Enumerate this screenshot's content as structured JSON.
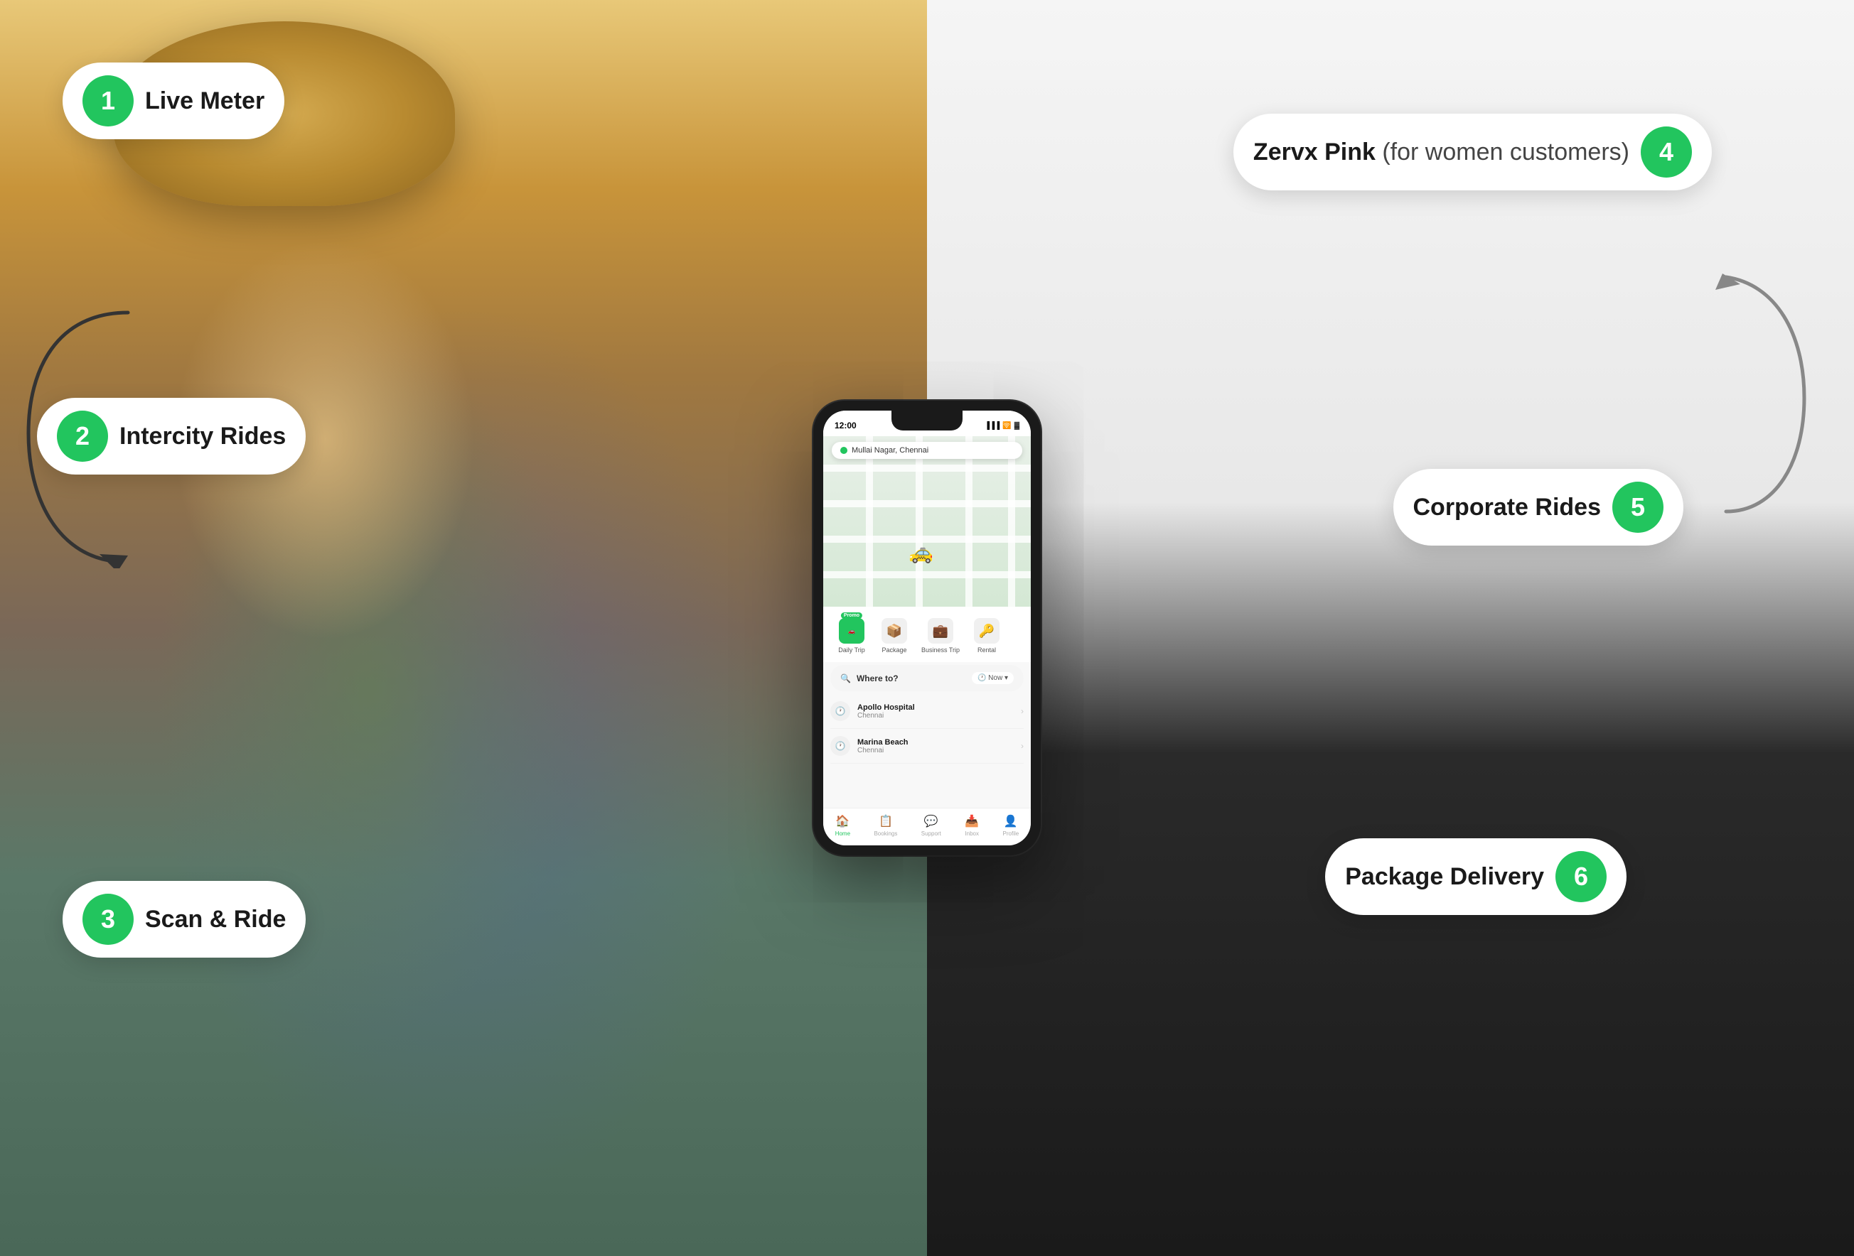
{
  "badges": {
    "b1": {
      "number": "1",
      "label": "Live Meter"
    },
    "b2": {
      "number": "2",
      "label": "Intercity Rides"
    },
    "b3": {
      "number": "3",
      "label": "Scan & Ride"
    },
    "b4": {
      "number": "4",
      "label": "Zervx Pink",
      "suffix": " (for women customers)"
    },
    "b5": {
      "number": "5",
      "label": "Corporate Rides"
    },
    "b6": {
      "number": "6",
      "label": "Package Delivery"
    }
  },
  "phone": {
    "time": "12:00",
    "location": "Mullai Nagar, Chennai",
    "where_to": "Where to?",
    "now": "Now",
    "tabs": [
      {
        "label": "Daily Trip",
        "icon": "🚗",
        "promo": true
      },
      {
        "label": "Package",
        "icon": "📦",
        "promo": false
      },
      {
        "label": "Business Trip",
        "icon": "💼",
        "promo": false
      },
      {
        "label": "Rental",
        "icon": "🔑",
        "promo": false
      }
    ],
    "places": [
      {
        "name": "Apollo Hospital",
        "city": "Chennai"
      },
      {
        "name": "Marina Beach",
        "city": "Chennai"
      }
    ],
    "nav": [
      {
        "label": "Home",
        "active": true
      },
      {
        "label": "Bookings",
        "active": false
      },
      {
        "label": "Support",
        "active": false
      },
      {
        "label": "Inbox",
        "active": false
      },
      {
        "label": "Profile",
        "active": false
      }
    ]
  }
}
